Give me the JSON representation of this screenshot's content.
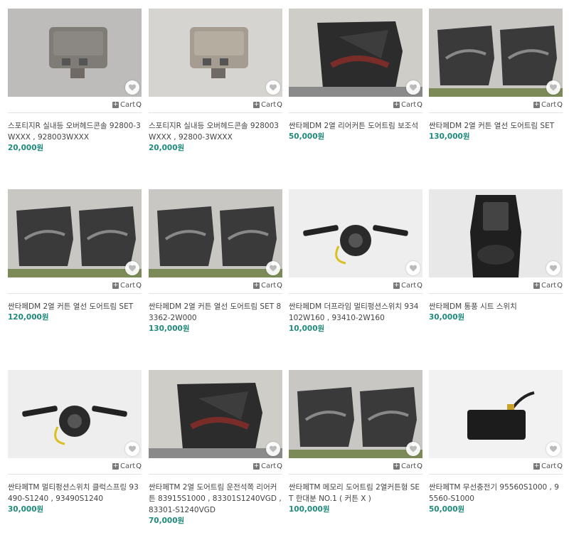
{
  "cart_label": "Cart",
  "products": [
    {
      "title": "스포티지R 실내등 오버헤드콘솔 92800-3WXXX , 928003WXXX",
      "price": "20,000원",
      "image": "overhead-console-photo"
    },
    {
      "title": "스포티지R 실내등 오버헤드콘솔 928003WXXX , 92800-3WXXX",
      "price": "20,000원",
      "image": "overhead-console-photo"
    },
    {
      "title": "싼타페DM 2열 리어커튼 도어트림 보조석",
      "price": "50,000원",
      "image": "door-trim-photo"
    },
    {
      "title": "싼타페DM 2열 커튼 열선 도어트림 SET",
      "price": "130,000원",
      "image": "door-trim-set-photo"
    },
    {
      "title": "싼타페DM 2열 커튼 열선 도어트림 SET",
      "price": "120,000원",
      "image": "door-trim-set-photo"
    },
    {
      "title": "싼타페DM 2열 커튼 열선 도어트림 SET 83362-2W000",
      "price": "130,000원",
      "image": "door-trim-set-photo"
    },
    {
      "title": "싼타페DM 더프라임 멀티펑션스위치 934102W160 , 93410-2W160",
      "price": "10,000원",
      "image": "multifunction-switch-photo"
    },
    {
      "title": "싼타페DM 통풍 시트 스위치",
      "price": "30,000원",
      "image": "seat-switch-photo"
    },
    {
      "title": "싼타페TM 멀티펑션스위치 클럭스프링 93490-S1240 , 93490S1240",
      "price": "30,000원",
      "image": "multifunction-switch-photo"
    },
    {
      "title": "싼타페TM 2열 도어트림 운전석쪽 리어커튼 83915S1000 , 83301S1240VGD , 83301-S1240VGD",
      "price": "70,000원",
      "image": "door-trim-photo"
    },
    {
      "title": "싼타페TM 메모리 도어트림 2열커튼형 SET 한대분 NO.1 ( 커튼 X )",
      "price": "100,000원",
      "image": "door-trim-set-photo"
    },
    {
      "title": "싼타페TM 무선충전기 95560S1000 , 95560-S1000",
      "price": "50,000원",
      "image": "wireless-charger-photo"
    }
  ]
}
